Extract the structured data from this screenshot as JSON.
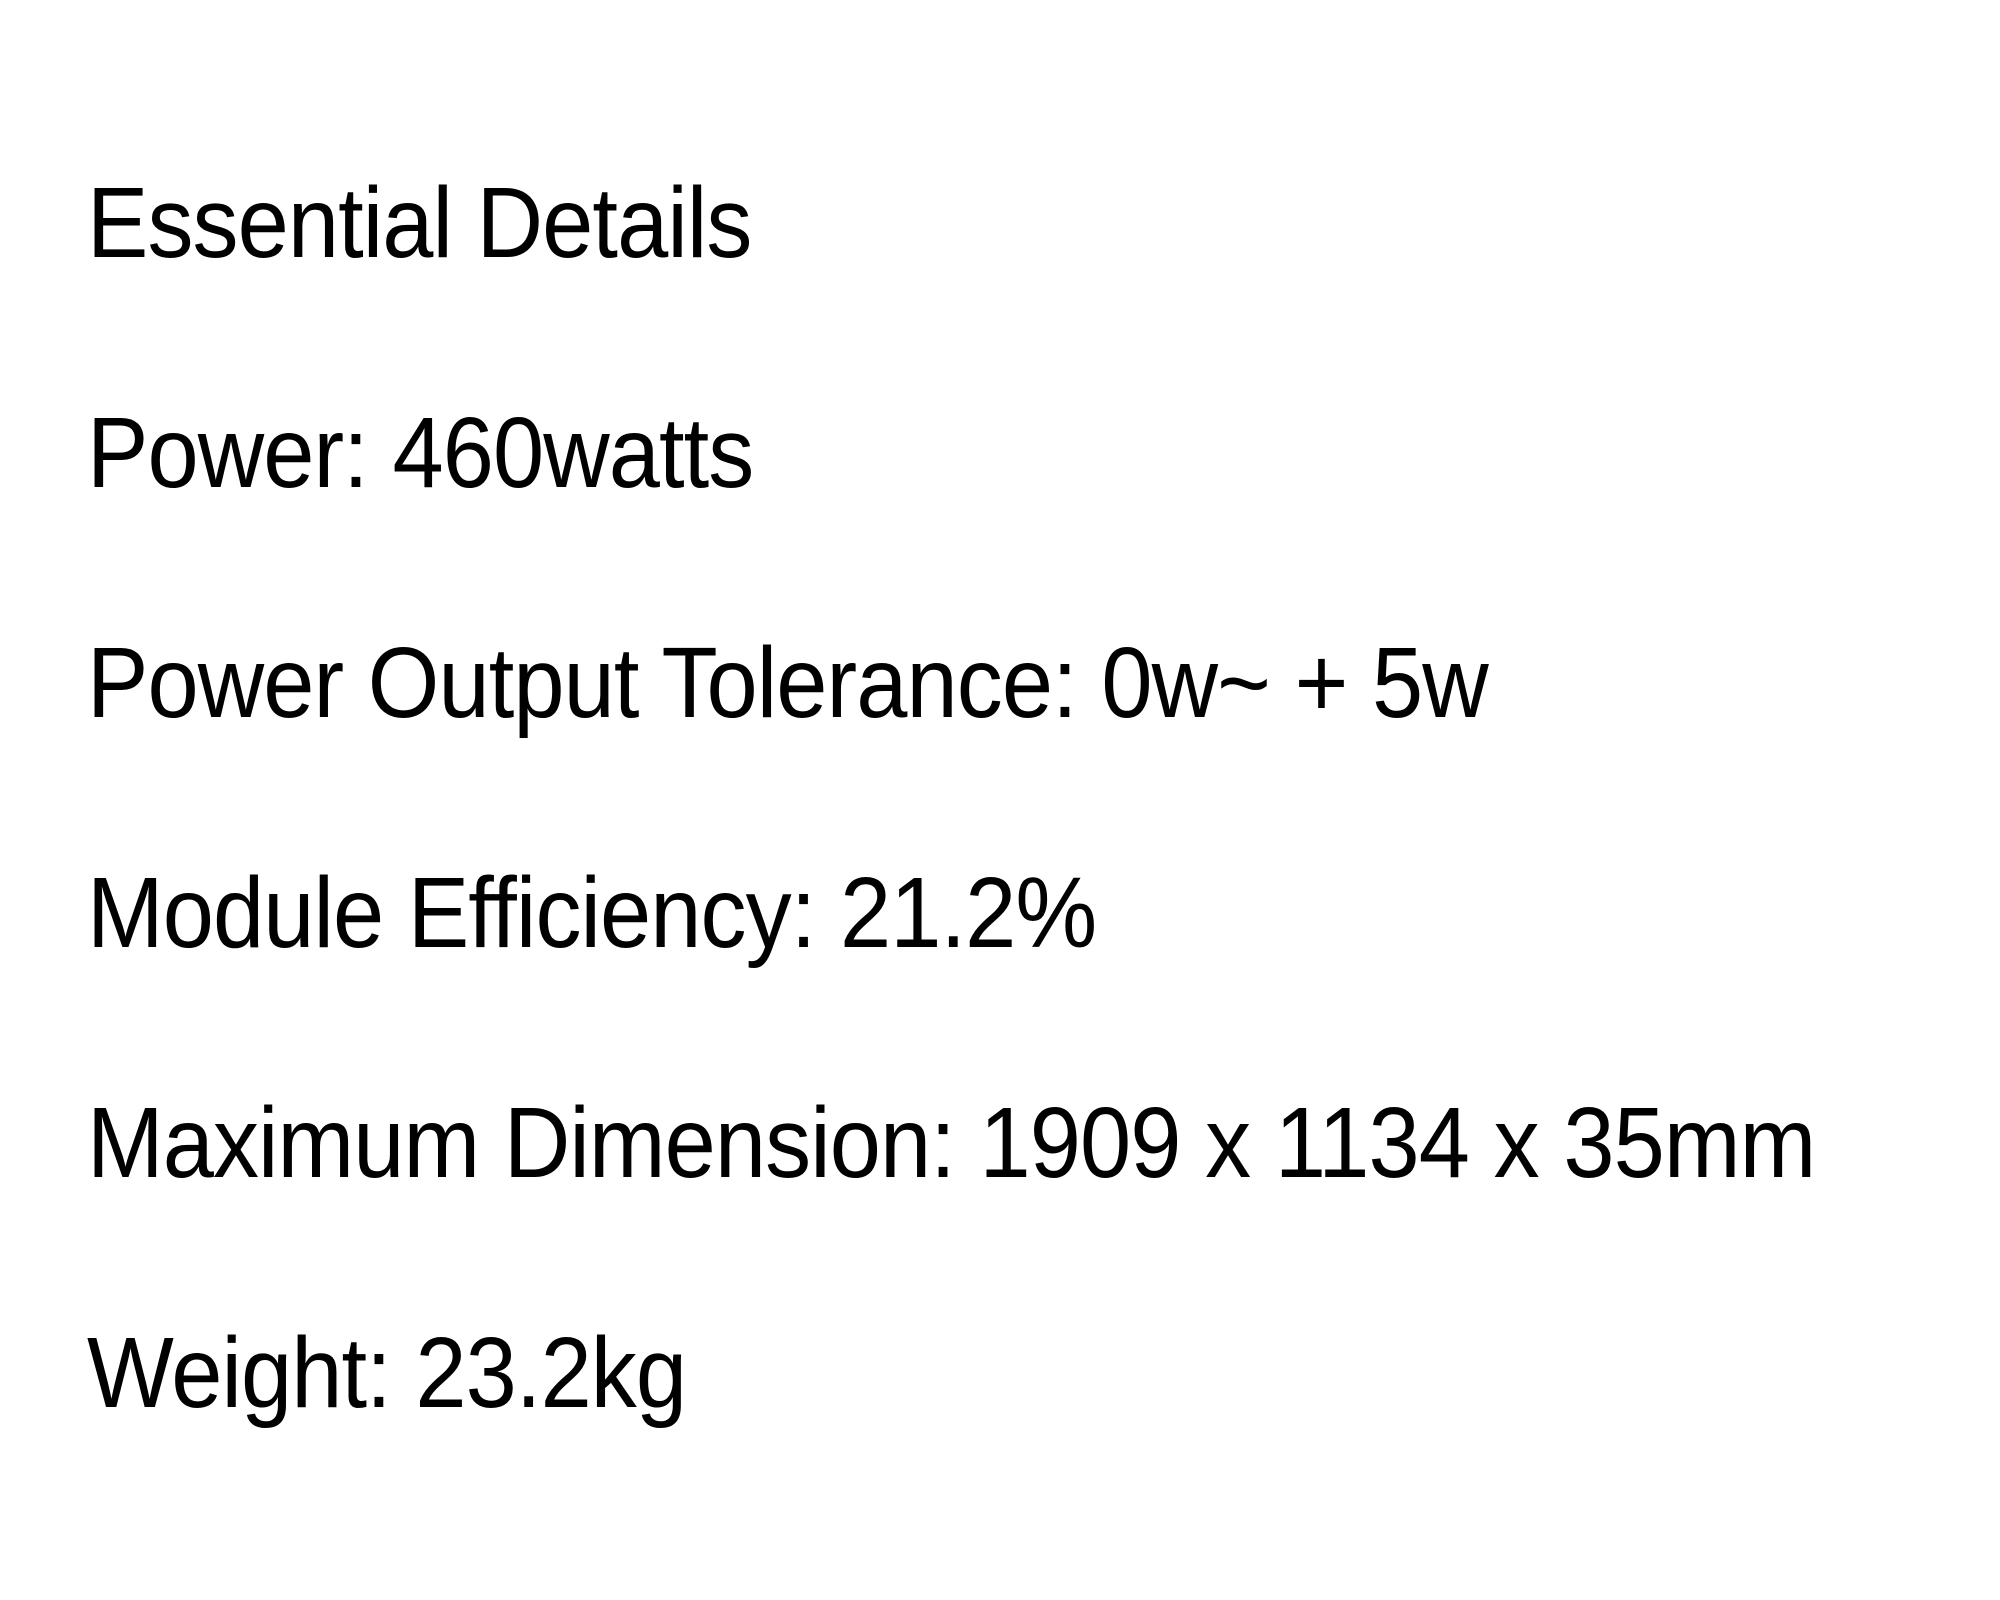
{
  "document": {
    "title": "Essential Details",
    "lines": [
      "Power: 460watts",
      "Power Output Tolerance: 0w~ + 5w",
      "Module Efficiency: 21.2%",
      "Maximum Dimension: 1909 x 1134 x 35mm",
      "Weight: 23.2kg"
    ]
  }
}
